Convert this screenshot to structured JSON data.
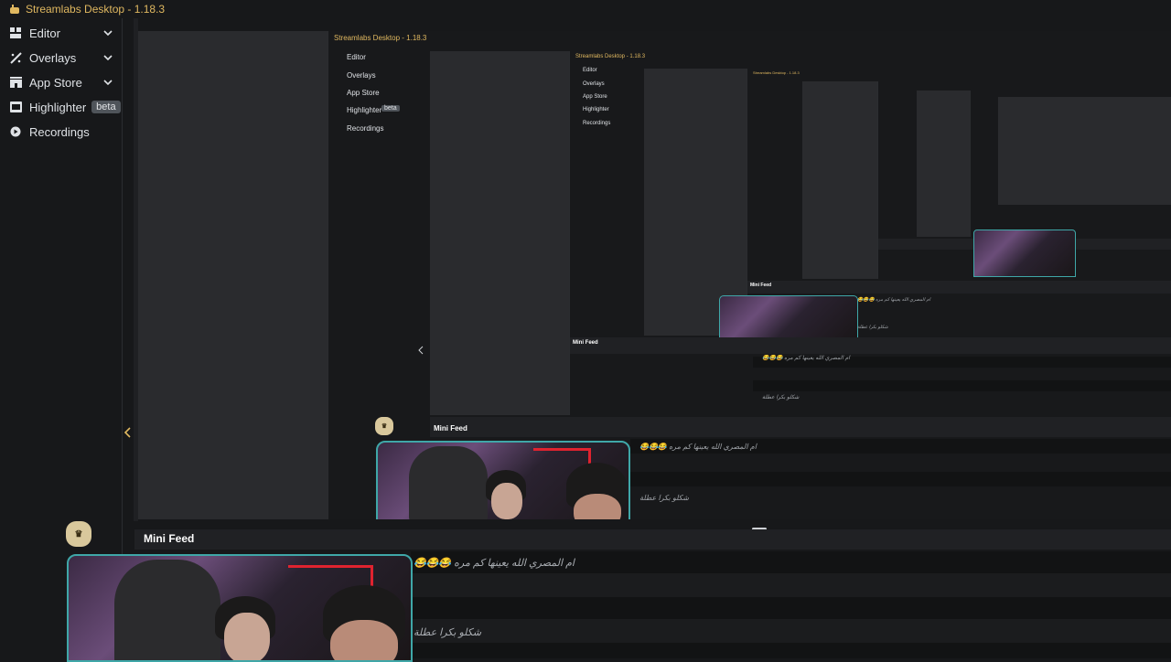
{
  "app": {
    "title": "Streamlabs Desktop - 1.18.3"
  },
  "sidebar": {
    "items": [
      {
        "label": "Editor",
        "icon": "editor-icon",
        "has_chevron": true
      },
      {
        "label": "Overlays",
        "icon": "overlays-icon",
        "has_chevron": true
      },
      {
        "label": "App Store",
        "icon": "app-store-icon",
        "has_chevron": true
      },
      {
        "label": "Highlighter",
        "icon": "highlighter-icon",
        "badge": "beta"
      },
      {
        "label": "Recordings",
        "icon": "recordings-icon"
      }
    ]
  },
  "feed": {
    "title": "Mini Feed",
    "messages": [
      "ام المصري الله يعينها كم مره 😂😂😂",
      "شكلو بكرا عطلة"
    ]
  },
  "colors": {
    "accent": "#e0b860",
    "background": "#17181a",
    "preview": "#2a2b2e",
    "cam_border": "#3fa7a8"
  }
}
